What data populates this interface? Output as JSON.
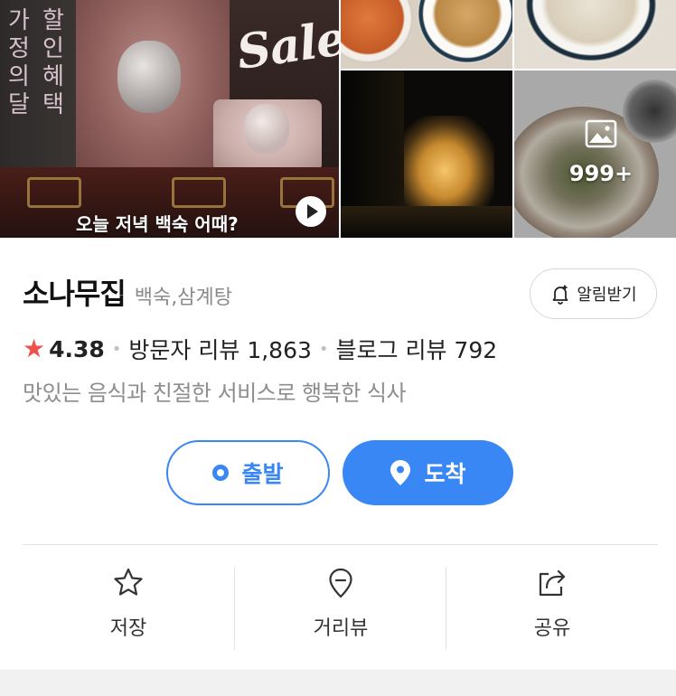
{
  "gallery": {
    "banner_side_text": [
      "가",
      "정",
      "의",
      "달"
    ],
    "banner_side_text_2": [
      "할",
      "인",
      "혜",
      "택"
    ],
    "banner_sale": "Sale",
    "banner_caption": "오늘 저녁 백숙 어때?",
    "more_count": "999+",
    "play_icon": "play-icon",
    "image_icon": "image-icon"
  },
  "place": {
    "name": "소나무집",
    "category": "백숙,삼계탕",
    "alarm_label": "알림받기",
    "rating": "4.38",
    "visitor_reviews": "방문자 리뷰 1,863",
    "blog_reviews": "블로그 리뷰 792",
    "description": "맛있는 음식과 친절한 서비스로 행복한 식사"
  },
  "buttons": {
    "depart": "출발",
    "arrive": "도착"
  },
  "actions": [
    {
      "label": "저장",
      "icon": "star-icon"
    },
    {
      "label": "거리뷰",
      "icon": "location-pin-icon"
    },
    {
      "label": "공유",
      "icon": "share-icon"
    }
  ],
  "colors": {
    "accent": "#3987f5",
    "rating_star": "#f0504c",
    "muted_text": "#8d8d8d"
  }
}
